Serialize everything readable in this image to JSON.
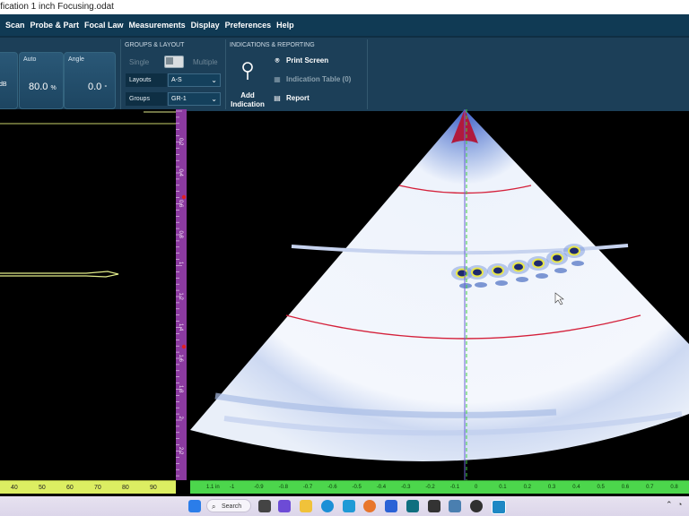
{
  "window": {
    "title": "ification 1 inch Focusing.odat"
  },
  "menu": [
    "Scan",
    "Probe & Part",
    "Focal Law",
    "Measurements",
    "Display",
    "Preferences",
    "Help"
  ],
  "cards": {
    "gain": {
      "unit": "dB"
    },
    "auto": {
      "label": "Auto",
      "value": "80.0",
      "unit": "%"
    },
    "angle": {
      "label": "Angle",
      "value": "0.0",
      "unit": "°"
    }
  },
  "groups_layout": {
    "title": "GROUPS & LAYOUT",
    "single": "Single",
    "multiple": "Multiple",
    "layouts_label": "Layouts",
    "layouts_value": "A-S",
    "groups_label": "Groups",
    "groups_value": "GR-1"
  },
  "indications": {
    "title": "INDICATIONS & REPORTING",
    "add_label": "Add Indication",
    "print": "Print Screen",
    "table": "Indication Table (0)",
    "report": "Report"
  },
  "ascan_axis": {
    "ticks": [
      "40",
      "50",
      "60",
      "70",
      "80",
      "90"
    ]
  },
  "vruler": {
    "ticks": [
      "0.2",
      "0.4",
      "0.6",
      "0.8",
      "1",
      "1.2",
      "1.4",
      "1.6",
      "1.8",
      "2",
      "2.2"
    ]
  },
  "hruler": {
    "unit": "in",
    "first_label": "1.1",
    "ticks": [
      "-1",
      "-0.9",
      "-0.8",
      "-0.7",
      "-0.6",
      "-0.5",
      "-0.4",
      "-0.3",
      "-0.2",
      "-0.1",
      "0",
      "0.1",
      "0.2",
      "0.3",
      "0.4",
      "0.5",
      "0.6",
      "0.7",
      "0.8"
    ]
  },
  "taskbar": {
    "search": "Search"
  },
  "colors": {
    "menubar": "#103a54",
    "ribbon": "#1c3f58",
    "ruler_purple": "#8b3aa0",
    "ruler_green": "#4cd64c",
    "ruler_yellow": "#dcee62",
    "arc_red": "#d4203a",
    "indication_yellow": "#e8e64a",
    "cursor_green": "#3fd13f"
  }
}
